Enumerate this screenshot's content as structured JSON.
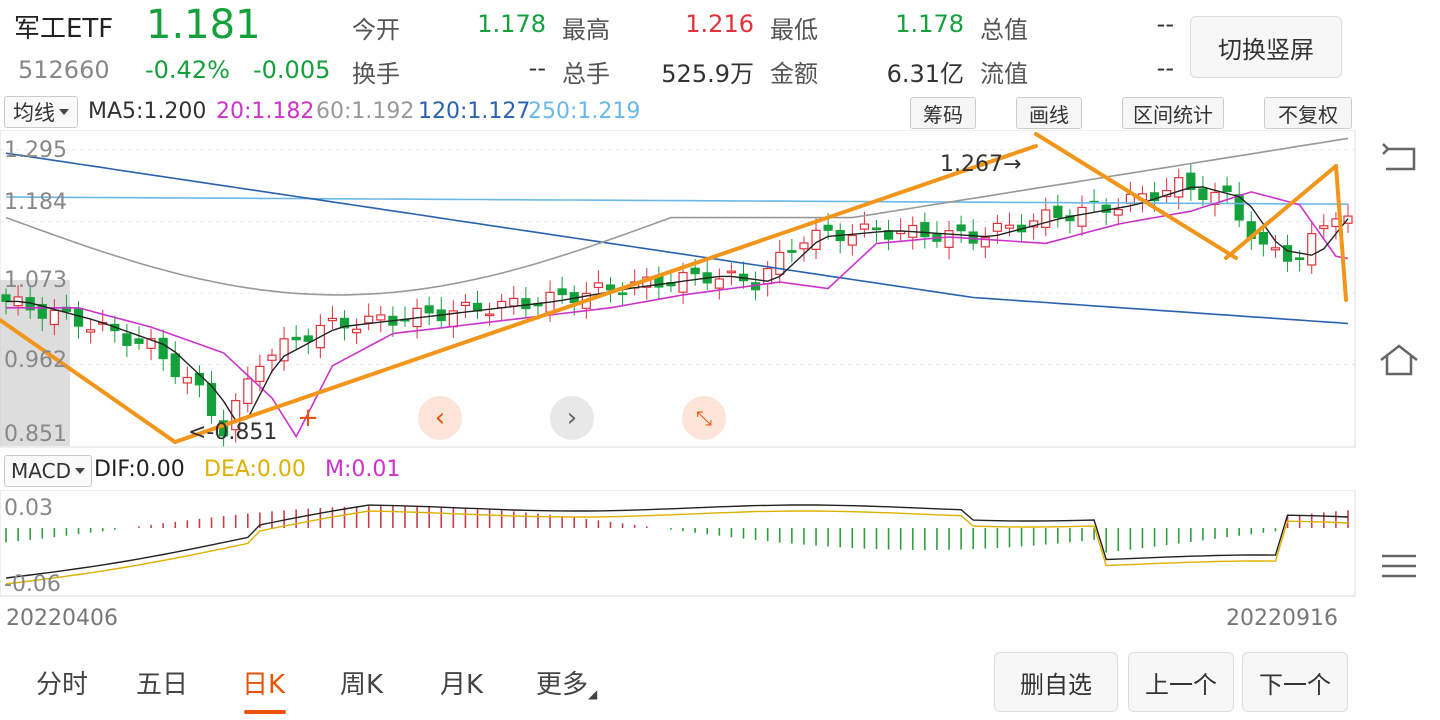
{
  "header": {
    "name": "军工ETF",
    "price": "1.181",
    "code": "512660",
    "change_pct": "-0.42%",
    "change": "-0.005",
    "stats": [
      {
        "label": "今开",
        "value": "1.178",
        "color": "#14a03a"
      },
      {
        "label": "最高",
        "value": "1.216",
        "color": "#e0323a"
      },
      {
        "label": "最低",
        "value": "1.178",
        "color": "#14a03a"
      },
      {
        "label": "总值",
        "value": "--",
        "color": "#333333"
      },
      {
        "label": "换手",
        "value": "--",
        "color": "#333333"
      },
      {
        "label": "总手",
        "value": "525.9万",
        "color": "#333333"
      },
      {
        "label": "金额",
        "value": "6.31亿",
        "color": "#333333"
      },
      {
        "label": "流值",
        "value": "--",
        "color": "#333333"
      }
    ],
    "switch_label": "切换竖屏"
  },
  "ma_bar": {
    "selector": "均线",
    "items": [
      {
        "text": "MA5:1.200",
        "color": "#333333"
      },
      {
        "text": "20:1.182",
        "color": "#cc33cc"
      },
      {
        "text": "60:1.192",
        "color": "#999999"
      },
      {
        "text": "120:1.127",
        "color": "#2a62b0"
      },
      {
        "text": "250:1.219",
        "color": "#6ab8e8"
      }
    ],
    "tools": [
      "筹码",
      "画线",
      "区间统计",
      "不复权"
    ]
  },
  "price_axis": [
    "1.295",
    "1.184",
    "1.073",
    "0.962",
    "0.851"
  ],
  "annotations": {
    "high": "1.267",
    "low": "0.851"
  },
  "macd_bar": {
    "selector": "MACD",
    "items": [
      {
        "text": "DIF:0.00",
        "color": "#222222"
      },
      {
        "text": "DEA:0.00",
        "color": "#e0b000"
      },
      {
        "text": "M:0.01",
        "color": "#cc33cc"
      }
    ],
    "axis": [
      "0.03",
      "-0.06"
    ]
  },
  "dates": {
    "start": "20220406",
    "end": "20220916"
  },
  "tabs": [
    {
      "label": "分时",
      "active": false
    },
    {
      "label": "五日",
      "active": false
    },
    {
      "label": "日K",
      "active": true
    },
    {
      "label": "周K",
      "active": false
    },
    {
      "label": "月K",
      "active": false
    },
    {
      "label": "更多",
      "active": false
    }
  ],
  "bottom_buttons": [
    "删自选",
    "上一个",
    "下一个"
  ],
  "icons": {
    "side": [
      "back-icon",
      "home-icon",
      "menu-icon"
    ],
    "chart_controls": [
      "plus-icon",
      "chevron-left-icon",
      "chevron-right-icon",
      "shrink-icon"
    ]
  },
  "chart_data": {
    "type": "candlestick",
    "title": "",
    "x_range": [
      "20220406",
      "20220916"
    ],
    "ylim": [
      0.851,
      1.295
    ],
    "ma": {
      "MA5": 1.2,
      "MA20": 1.182,
      "MA60": 1.192,
      "MA120": 1.127,
      "MA250": 1.219
    },
    "period_high": 1.267,
    "period_low": 0.851
  }
}
